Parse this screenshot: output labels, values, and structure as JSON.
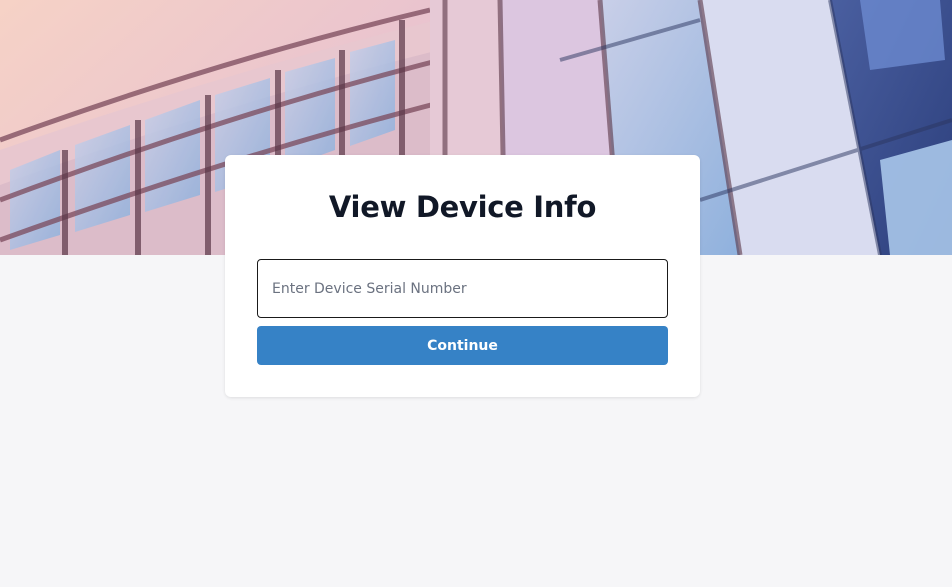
{
  "hero": {
    "image": "building-facade-photo"
  },
  "card": {
    "title": "View Device Info",
    "serial_input": {
      "placeholder": "Enter Device Serial Number",
      "value": ""
    },
    "continue_label": "Continue"
  },
  "colors": {
    "page_background": "#f6f6f8",
    "primary_button": "#3682c6",
    "title_text": "#111827"
  }
}
